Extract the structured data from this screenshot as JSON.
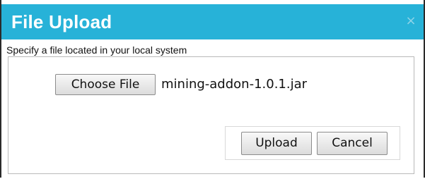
{
  "dialog": {
    "title": "File Upload",
    "close_symbol": "×",
    "close_icon": "close-icon",
    "title_bar_color": "#27b2d8"
  },
  "instruction": "Specify a file located in your local system",
  "file_input": {
    "button_label": "Choose File",
    "selected_file": "mining-addon-1.0.1.jar"
  },
  "actions": {
    "upload_label": "Upload",
    "cancel_label": "Cancel"
  }
}
